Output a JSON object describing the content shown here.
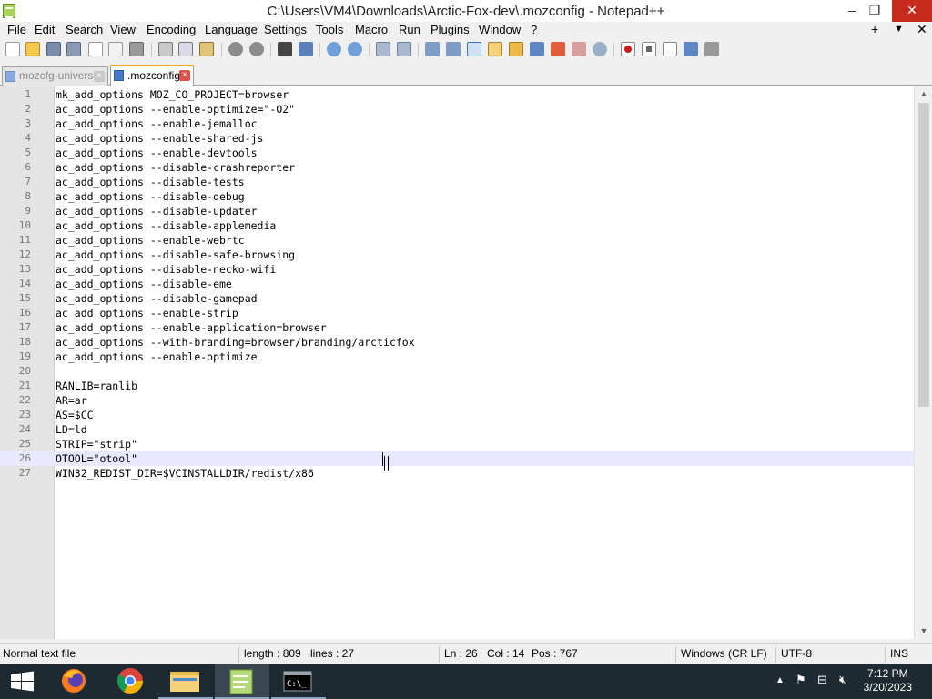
{
  "window": {
    "title": "C:\\Users\\VM4\\Downloads\\Arctic-Fox-dev\\.mozconfig - Notepad++",
    "minimize": "–",
    "restore": "❐",
    "close": "✕"
  },
  "menu": {
    "items": [
      "File",
      "Edit",
      "Search",
      "View",
      "Encoding",
      "Language",
      "Settings",
      "Tools",
      "Macro",
      "Run",
      "Plugins",
      "Window",
      "?"
    ],
    "plus": "+",
    "dropdown": "▼",
    "close": "✕"
  },
  "tabs": [
    {
      "label": "mozcfg-universal",
      "active": false
    },
    {
      "label": ".mozconfig",
      "active": true
    }
  ],
  "editor": {
    "current_line": 26,
    "lines": [
      "mk_add_options MOZ_CO_PROJECT=browser",
      "ac_add_options --enable-optimize=\"-O2\"",
      "ac_add_options --enable-jemalloc",
      "ac_add_options --enable-shared-js",
      "ac_add_options --enable-devtools",
      "ac_add_options --disable-crashreporter",
      "ac_add_options --disable-tests",
      "ac_add_options --disable-debug",
      "ac_add_options --disable-updater",
      "ac_add_options --disable-applemedia",
      "ac_add_options --enable-webrtc",
      "ac_add_options --disable-safe-browsing",
      "ac_add_options --disable-necko-wifi",
      "ac_add_options --disable-eme",
      "ac_add_options --disable-gamepad",
      "ac_add_options --enable-strip",
      "ac_add_options --enable-application=browser",
      "ac_add_options --with-branding=browser/branding/arcticfox",
      "ac_add_options --enable-optimize",
      "",
      "RANLIB=ranlib",
      "AR=ar",
      "AS=$CC",
      "LD=ld",
      "STRIP=\"strip\"",
      "OTOOL=\"otool\"",
      "WIN32_REDIST_DIR=$VCINSTALLDIR/redist/x86"
    ]
  },
  "status": {
    "file_type": "Normal text file",
    "length": "length : 809",
    "lines": "lines : 27",
    "ln": "Ln : 26",
    "col": "Col : 14",
    "pos": "Pos : 767",
    "eol": "Windows (CR LF)",
    "encoding": "UTF-8",
    "mode": "INS"
  },
  "taskbar": {
    "time": "7:12 PM",
    "date": "3/20/2023",
    "apps": [
      "start-icon",
      "firefox-icon",
      "chrome-icon",
      "file-explorer-icon",
      "notepadpp-icon",
      "cmd-icon"
    ]
  },
  "colors": {
    "current_line": "#e8e8ff",
    "active_tab_accent": "#f5a623",
    "taskbar": "#1e2a32"
  }
}
